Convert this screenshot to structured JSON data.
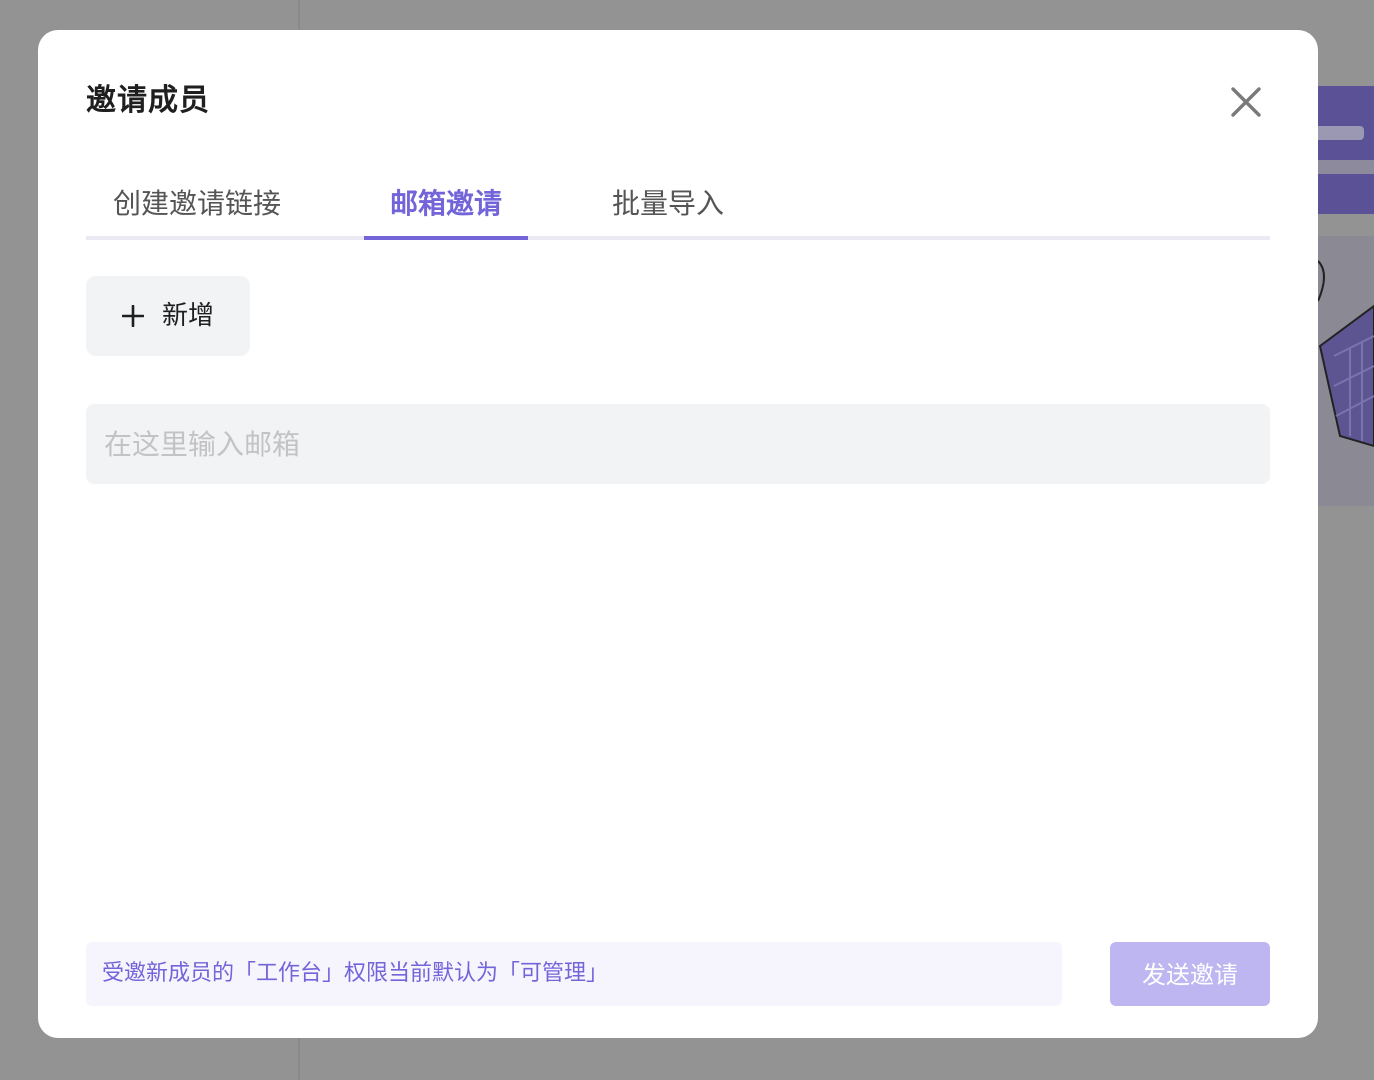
{
  "modal": {
    "title": "邀请成员",
    "close_icon": "close-icon"
  },
  "tabs": [
    {
      "label": "创建邀请链接",
      "active": false
    },
    {
      "label": "邮箱邀请",
      "active": true
    },
    {
      "label": "批量导入",
      "active": false
    }
  ],
  "add_button": {
    "icon": "plus-icon",
    "label": "新增"
  },
  "email_input": {
    "placeholder": "在这里输入邮箱",
    "value": ""
  },
  "footer": {
    "notice": "受邀新成员的「工作台」权限当前默认为「可管理」",
    "send_label": "发送邀请"
  },
  "colors": {
    "accent": "#7365d9",
    "accent_disabled": "#bdb6f1",
    "overlay": "#939393"
  }
}
